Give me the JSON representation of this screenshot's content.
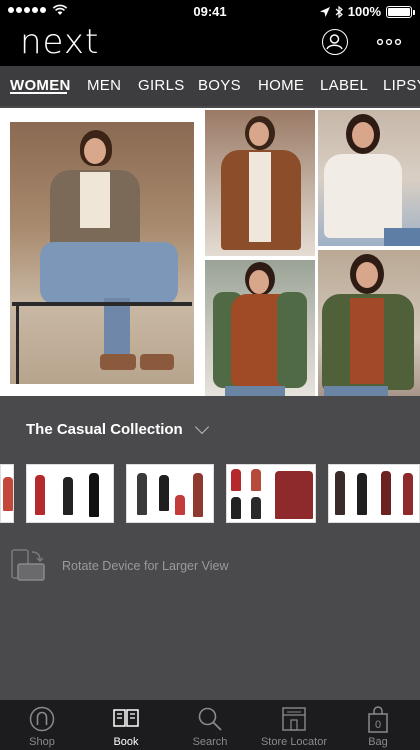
{
  "status_bar": {
    "time": "09:41",
    "battery": "100%"
  },
  "app": {
    "logo": "next"
  },
  "nav": {
    "categories": [
      "WOMEN",
      "MEN",
      "GIRLS",
      "BOYS",
      "HOME",
      "LABEL",
      "LIPSY"
    ],
    "active": "WOMEN"
  },
  "collection": {
    "title": "The Casual Collection"
  },
  "rotate_hint": "Rotate Device for Larger View",
  "tabs": [
    {
      "label": "Shop",
      "icon": "shop-icon"
    },
    {
      "label": "Book",
      "icon": "book-icon",
      "active": true
    },
    {
      "label": "Search",
      "icon": "search-icon"
    },
    {
      "label": "Store Locator",
      "icon": "store-locator-icon"
    },
    {
      "label": "Bag",
      "icon": "bag-icon",
      "count": "0"
    }
  ]
}
